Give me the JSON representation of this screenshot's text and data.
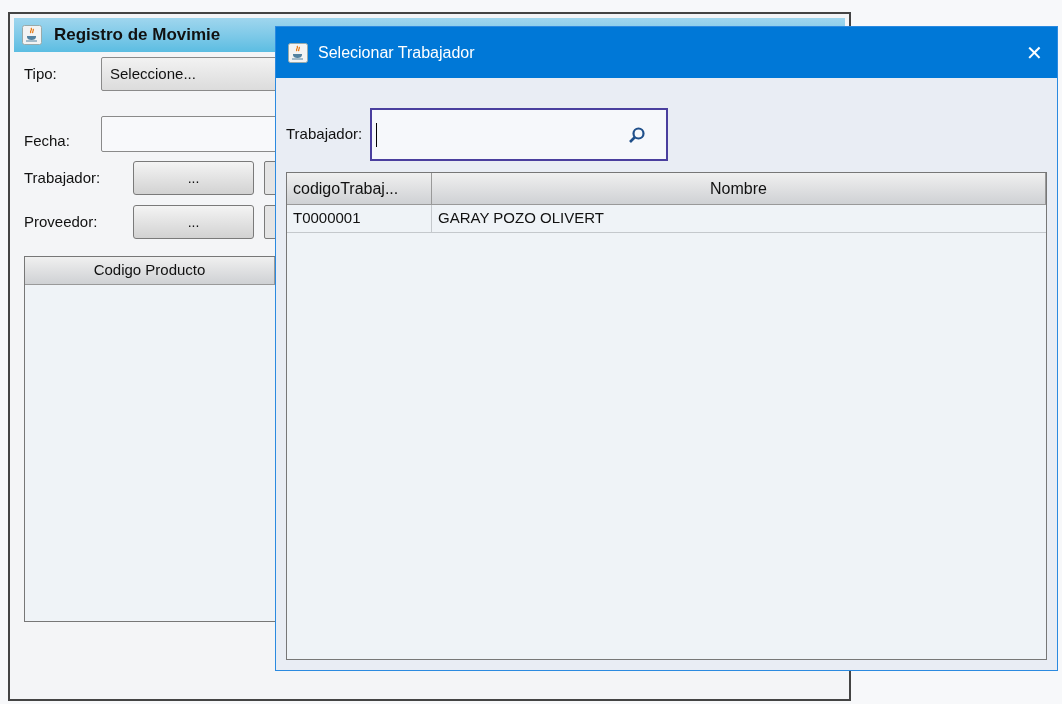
{
  "main_window": {
    "title": "Registro de Movimie",
    "fields": [
      {
        "label": "Tipo:",
        "kind": "select",
        "value": "Seleccione..."
      },
      {
        "label": "Fecha:",
        "kind": "date"
      },
      {
        "label": "Trabajador:",
        "kind": "picker",
        "button_text": "..."
      },
      {
        "label": "Proveedor:",
        "kind": "picker",
        "button_text": "..."
      }
    ],
    "table": {
      "columns": [
        "Codigo Producto"
      ]
    }
  },
  "dialog": {
    "title": "Selecionar Trabajador",
    "close": "✕",
    "search": {
      "label": "Trabajador:"
    },
    "table": {
      "columns": [
        "codigoTrabaj...",
        "Nombre"
      ],
      "rows": [
        [
          "T0000001",
          "GARAY POZO OLIVERT"
        ]
      ]
    }
  }
}
